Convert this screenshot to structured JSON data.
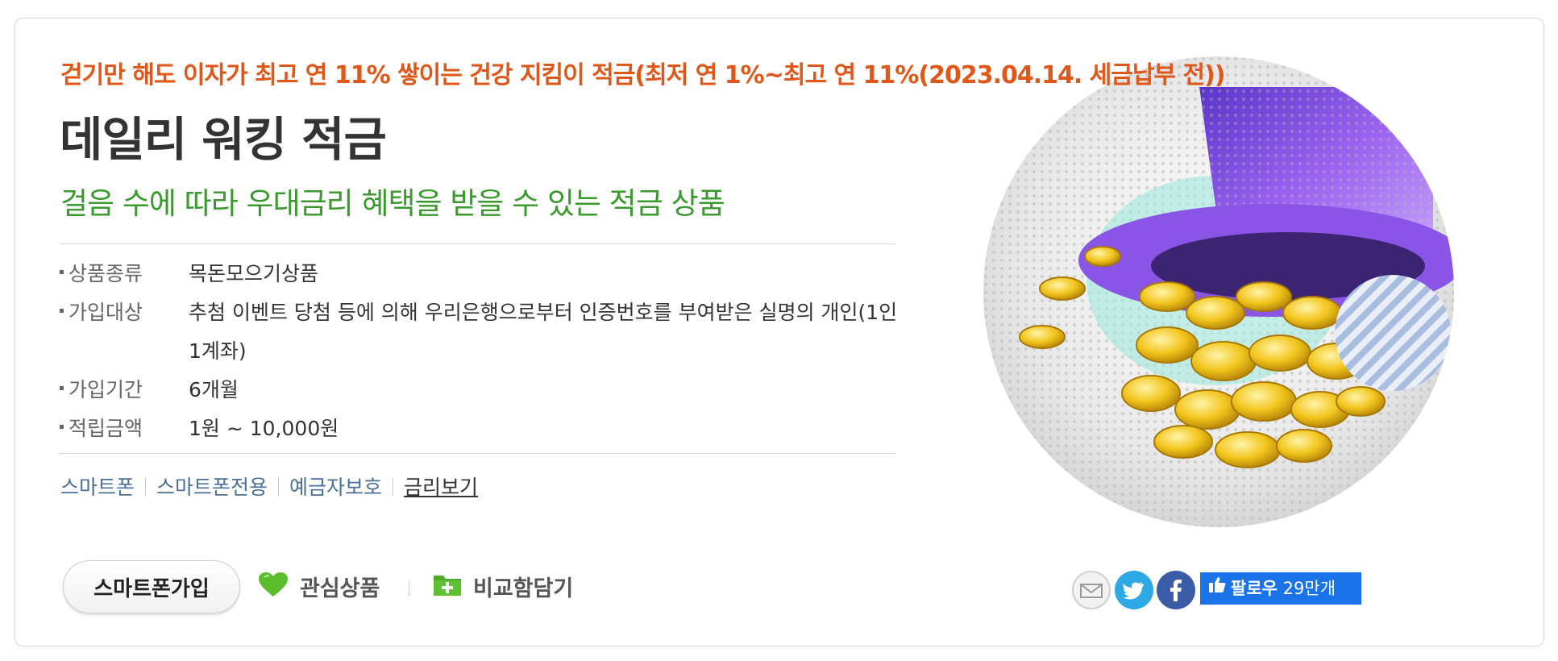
{
  "product": {
    "tagline": "걷기만 해도 이자가 최고 연 11% 쌓이는 건강 지킴이 적금(최저 연 1%~최고 연 11%(2023.04.14. 세금납부 전))",
    "title": "데일리 워킹 적금",
    "subtitle": "걸음 수에 따라 우대금리 혜택을 받을 수 있는 적금 상품"
  },
  "details": [
    {
      "label": "상품종류",
      "value": "목돈모으기상품"
    },
    {
      "label": "가입대상",
      "value": "추첨 이벤트 당첨 등에 의해 우리은행으로부터 인증번호를 부여받은 실명의 개인(1인 1계좌)"
    },
    {
      "label": "가입기간",
      "value": "6개월"
    },
    {
      "label": "적립금액",
      "value": "1원 ~ 10,000원"
    }
  ],
  "tags": [
    "스마트폰",
    "스마트폰전용",
    "예금자보호",
    "금리보기"
  ],
  "actions": {
    "join_label": "스마트폰가입",
    "favorite_label": "관심상품",
    "compare_label": "비교함담기"
  },
  "social": {
    "follow_label": "팔로우",
    "follow_count": "29만개",
    "icons": [
      "email-icon",
      "twitter-icon",
      "facebook-icon"
    ]
  },
  "colors": {
    "tagline": "#e0571a",
    "subtitle": "#3a9a2e",
    "follow_button": "#1a73e8"
  }
}
